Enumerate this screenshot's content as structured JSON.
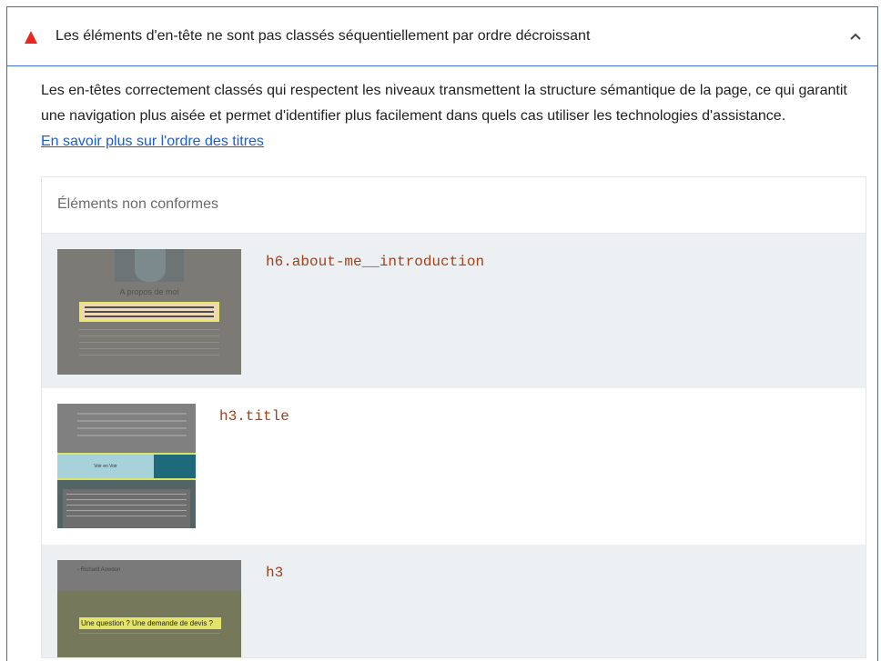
{
  "audit": {
    "title": "Les éléments d'en-tête ne sont pas classés séquentiellement par ordre décroissant",
    "status_icon": "warning-triangle-icon",
    "status_color": "#e8271f",
    "expand_icon": "chevron-up-icon",
    "description": "Les en-têtes correctement classés qui respectent les niveaux transmettent la structure sémantique de la page, ce qui garantit une navigation plus aisée et permet d'identifier plus facilement dans quels cas utiliser les technologies d'assistance.",
    "learn_more_link": "En savoir plus sur l'ordre des titres"
  },
  "table": {
    "header": "Éléments non conformes",
    "rows": [
      {
        "selector": "h6.about-me__introduction",
        "thumbnail": {
          "title": "A propos de moi"
        }
      },
      {
        "selector": "h3.title",
        "thumbnail": {
          "band_label": "Voir en Voir"
        }
      },
      {
        "selector": "h3",
        "thumbnail": {
          "name": "- Richard Aowdon",
          "question": "Une question ? Une demande de devis ?"
        }
      }
    ]
  },
  "colors": {
    "link": "#1a5cd6",
    "selector": "#a1401b",
    "header_border": "#3c6ecf",
    "row_alt": "#edf0f3"
  }
}
